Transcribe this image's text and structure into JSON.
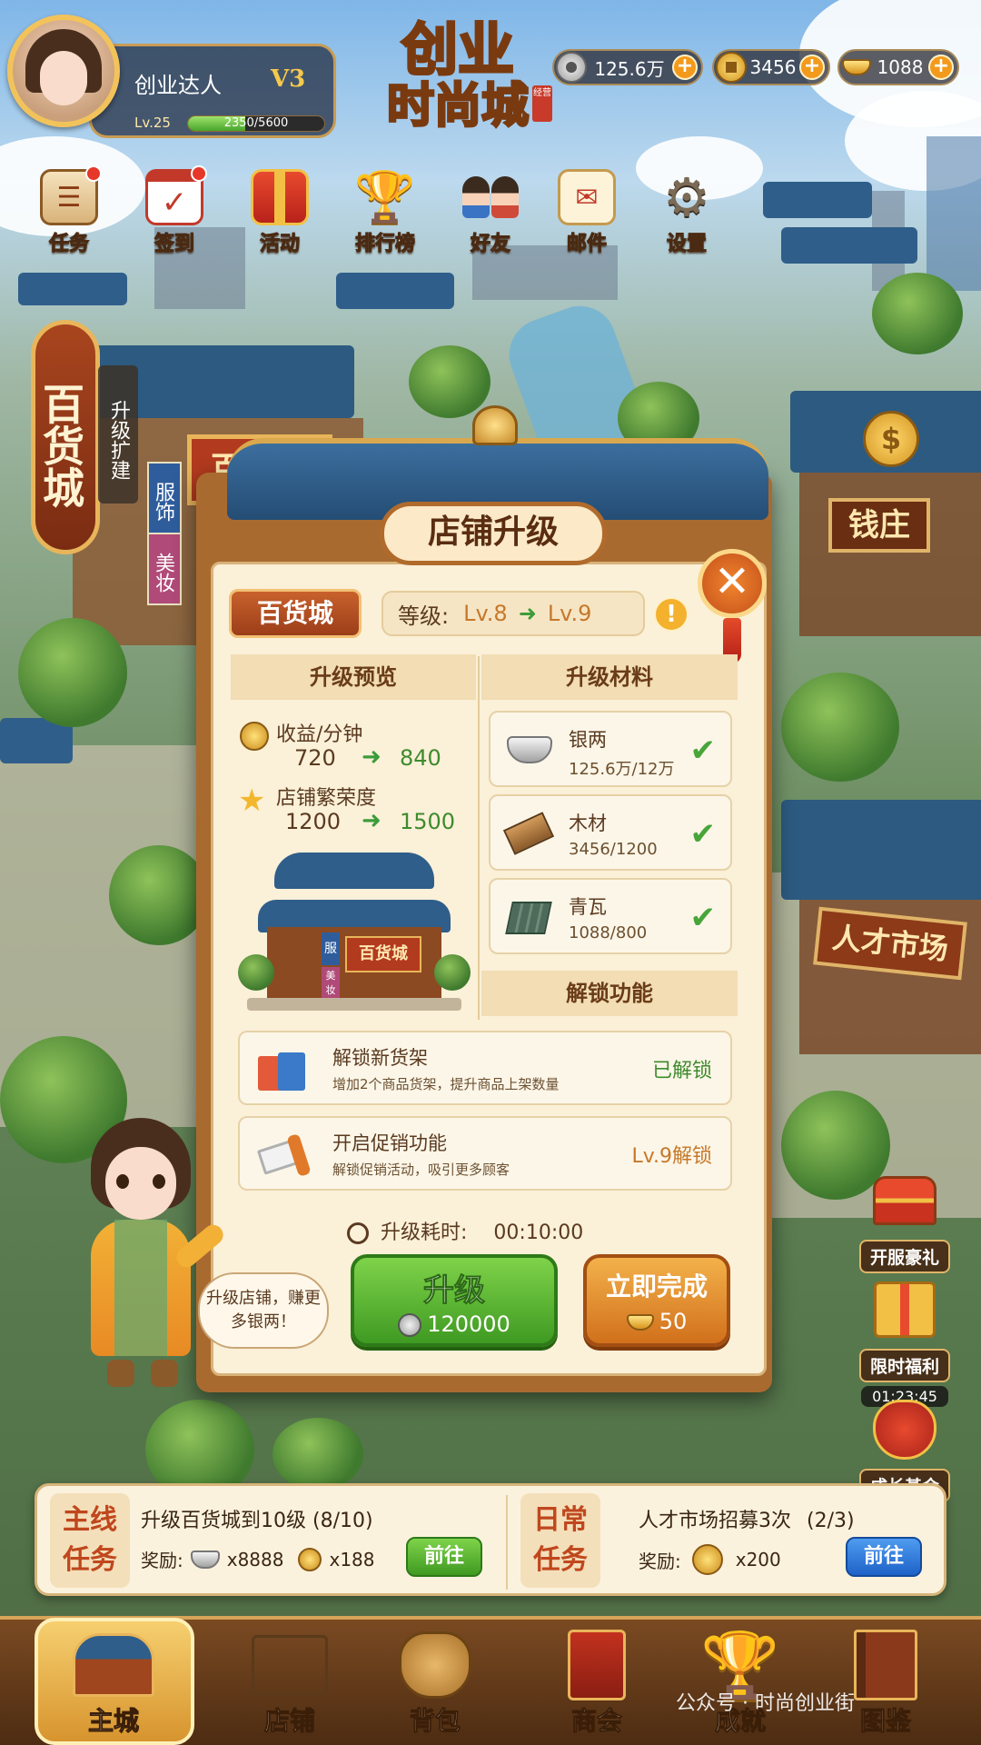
{
  "player": {
    "name": "创业达人",
    "vip": "V3",
    "level": "Lv.25",
    "xp_text": "2350/5600",
    "xp_fraction": 0.42
  },
  "logo": {
    "line1": "创业",
    "line2": "时尚城",
    "seal": "经营"
  },
  "currencies": [
    {
      "icon": "silver-coin-icon",
      "value": "125.6万",
      "plus": "+"
    },
    {
      "icon": "gold-coin-icon",
      "value": "3456",
      "plus": "+"
    },
    {
      "icon": "gold-ingot-icon",
      "value": "1088",
      "plus": "+"
    }
  ],
  "menu": [
    {
      "icon": "scroll-icon",
      "label": "任务",
      "badge": true
    },
    {
      "icon": "calendar-icon",
      "label": "签到",
      "badge": true
    },
    {
      "icon": "gift-icon",
      "label": "活动",
      "badge": false
    },
    {
      "icon": "trophy-icon",
      "label": "排行榜",
      "badge": false
    },
    {
      "icon": "friends-icon",
      "label": "好友",
      "badge": false
    },
    {
      "icon": "mail-icon",
      "label": "邮件",
      "badge": false
    },
    {
      "icon": "gear-icon",
      "label": "设置",
      "badge": false
    }
  ],
  "map": {
    "store_banner": "百货城",
    "upgrade_tag": "升级扩建",
    "store_sign": "百货城",
    "side_signs": [
      "服饰",
      "美妆"
    ],
    "bank_sign": "钱庄",
    "talent_sign": "人才市场"
  },
  "modal": {
    "title": "店铺升级",
    "close": "✕",
    "shop_name": "百货城",
    "level_label": "等级:",
    "level_from": "Lv.8",
    "level_to": "Lv.9",
    "arrow": "➜",
    "warn": "!",
    "preview_header": "升级预览",
    "materials_header": "升级材料",
    "unlock_header": "解锁功能",
    "preview": [
      {
        "icon": "coin-icon",
        "label": "收益/分钟",
        "from": "720",
        "to": "840"
      },
      {
        "icon": "star-icon",
        "label": "店铺繁荣度",
        "from": "1200",
        "to": "1500"
      }
    ],
    "building_sign": "百货城",
    "building_side": [
      "服",
      "美妆"
    ],
    "materials": [
      {
        "icon": "silver-ingot-icon",
        "name": "银两",
        "qty": "125.6万/12万",
        "check": "✔"
      },
      {
        "icon": "wood-icon",
        "name": "木材",
        "qty": "3456/1200",
        "check": "✔"
      },
      {
        "icon": "tile-icon",
        "name": "青瓦",
        "qty": "1088/800",
        "check": "✔"
      }
    ],
    "unlocks": [
      {
        "icon": "shopping-bags-icon",
        "title": "解锁新货架",
        "desc": "增加2个商品货架，提升商品上架数量",
        "status": "已解锁",
        "status_color": "#3e8b2e"
      },
      {
        "icon": "megaphone-icon",
        "title": "开启促销功能",
        "desc": "解锁促销活动，吸引更多顾客",
        "status": "Lv.9解锁",
        "status_color": "#c6782a"
      }
    ],
    "timer_label": "升级耗时:",
    "timer_value": "00:10:00",
    "upgrade_button": {
      "label": "升级",
      "cost": "120000"
    },
    "instant_button": {
      "label": "立即完成",
      "cost": "50"
    }
  },
  "guide": {
    "bubble": "升级店铺，赚更多银两！"
  },
  "events": [
    {
      "icon": "treasure-chest-icon",
      "label": "开服豪礼"
    },
    {
      "icon": "gift-box-icon",
      "label": "限时福利",
      "timer": "01:23:45"
    },
    {
      "icon": "money-bag-icon",
      "label": "成长基金"
    }
  ],
  "tasks": {
    "main": {
      "tag": "主线任务",
      "name": "升级百货城到10级",
      "progress": "(8/10)",
      "reward_label": "奖励:",
      "rewards": [
        {
          "icon": "silver-ingot-icon",
          "qty": "x8888"
        },
        {
          "icon": "coin-icon",
          "qty": "x188"
        }
      ],
      "button": "前往"
    },
    "daily": {
      "tag": "日常任务",
      "name": "人才市场招募3次",
      "progress": "(2/3)",
      "reward_label": "奖励:",
      "rewards": [
        {
          "icon": "coin-icon",
          "qty": "x200"
        }
      ],
      "button": "前往"
    }
  },
  "nav": [
    {
      "icon": "palace-icon",
      "label": "主城",
      "active": true
    },
    {
      "icon": "shop-icon",
      "label": "店铺"
    },
    {
      "icon": "bag-icon",
      "label": "背包"
    },
    {
      "icon": "guild-icon",
      "label": "商会"
    },
    {
      "icon": "trophy-icon",
      "label": "成就"
    },
    {
      "icon": "book-icon",
      "label": "图鉴"
    }
  ],
  "watermark": "公众号 · 时尚创业街",
  "colors": {
    "accent_green": "#3e8b2e",
    "accent_orange": "#c6782a",
    "panel": "#fbf0d8",
    "wood": "#a96a30"
  }
}
